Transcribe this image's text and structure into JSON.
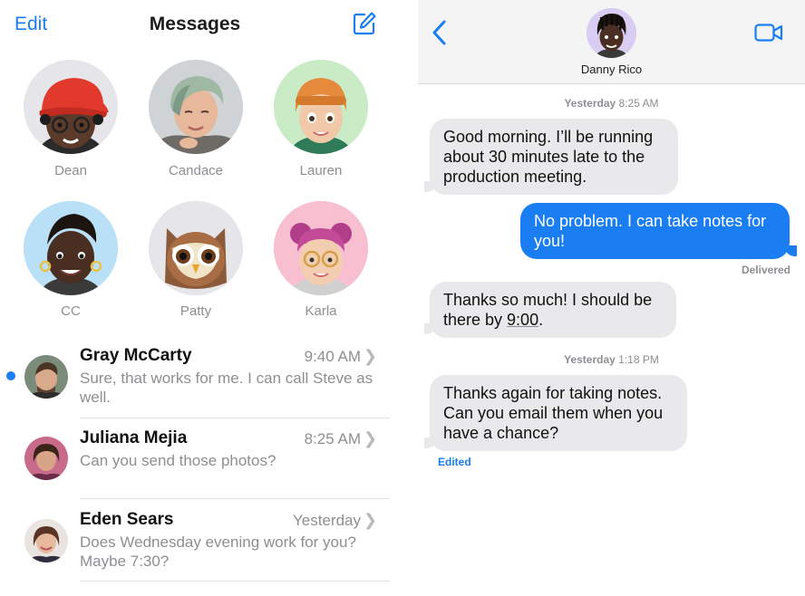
{
  "list": {
    "edit_label": "Edit",
    "title": "Messages",
    "compose_icon": "compose-icon",
    "pinned": [
      {
        "name": "Dean"
      },
      {
        "name": "Candace"
      },
      {
        "name": "Lauren"
      },
      {
        "name": "CC"
      },
      {
        "name": "Patty"
      },
      {
        "name": "Karla"
      }
    ],
    "conversations": [
      {
        "name": "Gray McCarty",
        "time": "9:40 AM",
        "preview": "Sure, that works for me. I can call Steve as well.",
        "unread": true
      },
      {
        "name": "Juliana Mejia",
        "time": "8:25 AM",
        "preview": "Can you send those photos?",
        "unread": false
      },
      {
        "name": "Eden Sears",
        "time": "Yesterday",
        "preview": "Does Wednesday evening work for you? Maybe 7:30?",
        "unread": false
      }
    ]
  },
  "thread": {
    "contact_name": "Danny Rico",
    "back_icon": "chevron-left-icon",
    "video_icon": "video-camera-icon",
    "timestamps": [
      {
        "day": "Yesterday",
        "time": "8:25 AM"
      },
      {
        "day": "Yesterday",
        "time": "1:18 PM"
      }
    ],
    "messages": [
      {
        "direction": "incoming",
        "text": "Good morning. I’ll be running about 30 minutes late to the production meeting."
      },
      {
        "direction": "outgoing",
        "text": "No problem. I can take notes for you!"
      },
      {
        "direction": "incoming",
        "text_before": "Thanks so much! I should be there by ",
        "text_time": "9:00",
        "text_after": "."
      },
      {
        "direction": "incoming",
        "text": "Thanks again for taking notes. Can you email them when you have a chance?"
      }
    ],
    "delivered_label": "Delivered",
    "edited_label": "Edited"
  },
  "colors": {
    "accent": "#1a7ef2",
    "incoming_bubble": "#e9e9eb",
    "secondary_text": "#8e8e93"
  }
}
